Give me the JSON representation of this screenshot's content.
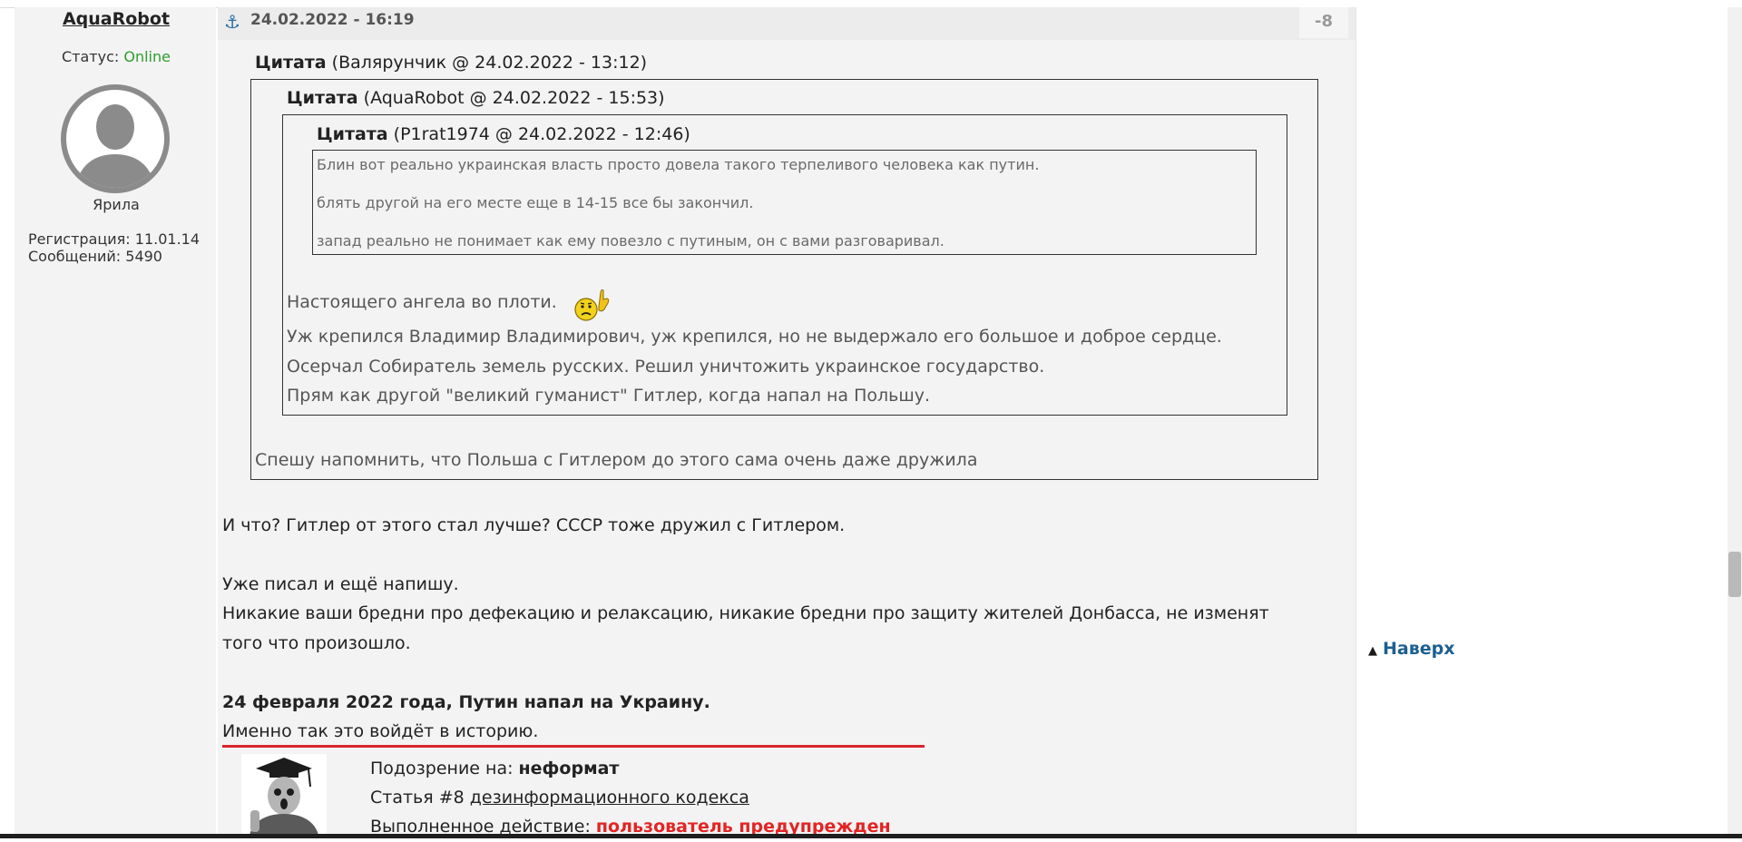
{
  "post": {
    "author": "AquaRobot",
    "status_label": "Статус:",
    "status_value": "Online",
    "rank": "Ярила",
    "registration": "Регистрация: 11.01.14",
    "messages": "Сообщений: 5490",
    "date": "24.02.2022 - 16:19",
    "rating": "-8"
  },
  "quote_outer": {
    "title": "Цитата",
    "meta": "(Валярунчик @ 24.02.2022 - 13:12)",
    "reply": "Спешу напомнить, что Польша с Гитлером до этого сама очень даже дружила"
  },
  "quote_middle": {
    "title": "Цитата",
    "meta": "(AquaRobot @ 24.02.2022 - 15:53)",
    "lines": [
      "Настоящего ангела во плоти.",
      "Уж крепился Владимир Владимирович, уж крепился, но не выдержало его большое и доброе сердце.",
      "Осерчал Собиратель земель русских. Решил уничтожить украинское государство.",
      "Прям как другой \"великий гуманист\" Гитлер, когда напал на Польшу."
    ]
  },
  "quote_inner": {
    "title": "Цитата",
    "meta": "(P1rat1974 @ 24.02.2022 - 12:46)",
    "lines": [
      "Блин вот реально украинская власть просто довела такого терпеливого человека как путин.",
      "блять другой на его месте еще в 14-15 все бы закончил.",
      "запад реально не понимает как ему повезло с путиным, он с вами разговаривал."
    ]
  },
  "body": {
    "line1": "И что? Гитлер от этого стал лучше? СССР тоже дружил с Гитлером.",
    "line2": "Уже писал и ещё напишу.",
    "line3": "Никакие ваши бредни про дефекацию и релаксацию, никакие бредни про защиту жителей Донбасса, не изменят",
    "line4": "того что произошло.",
    "signature_bold": "24 февраля 2022 года, Путин напал на Украину.",
    "signature_line": "Именно так это войдёт в историю."
  },
  "warning": {
    "suspicion_label": "Подозрение на:",
    "suspicion_value": "неформат",
    "article_label": "Статья #8",
    "article_link": "дезинформационного кодекса",
    "action_label": "Выполненное действие:",
    "action_value": "пользователь предупрежден"
  },
  "sidebar": {
    "to_top": "Наверх"
  },
  "colors": {
    "online": "#2e9e2e",
    "link": "#1d5f8f",
    "warning_red": "#e32424",
    "separator_red": "#d8262c"
  },
  "icons": [
    "anchor-icon",
    "avatar-silhouette",
    "suspicious-smiley-icon",
    "arrow-up-icon"
  ]
}
